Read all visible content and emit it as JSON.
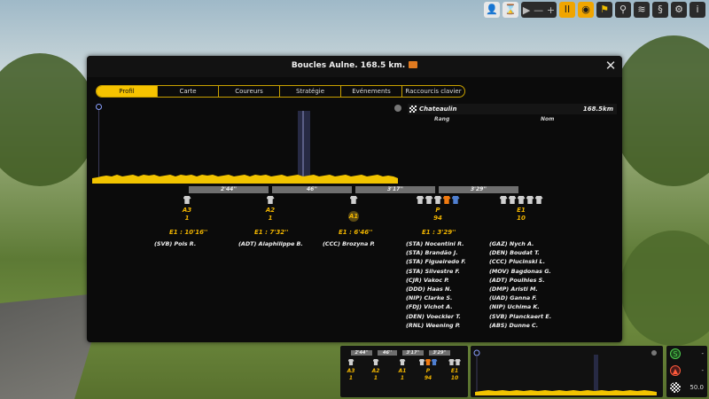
{
  "toolbar": {
    "items": [
      "user-icon",
      "hourglass-icon",
      "play-icon",
      "minus-icon",
      "plus-icon",
      "pause-icon",
      "eye-icon",
      "flag-icon",
      "bike-icon",
      "speed-icon",
      "s-icon",
      "settings-icon",
      "info-icon"
    ],
    "pause_symbol": "II",
    "minus_symbol": "—",
    "plus_symbol": "+",
    "info_symbol": "i"
  },
  "modal": {
    "title": "Boucles Aulne. 168.5 km.",
    "close_symbol": "✕",
    "tabs": [
      "Profil",
      "Carte",
      "Coureurs",
      "Stratégie",
      "Evénements",
      "Raccourcis clavier"
    ],
    "active_tab": "Profil"
  },
  "stage": {
    "place": "Chateaulin",
    "distance": "168.5km",
    "col_rank": "Rang",
    "col_name": "Nom",
    "gaps": [
      "2'44''",
      "46''",
      "3'17''",
      "3'29''"
    ]
  },
  "groups": [
    {
      "label": "A3",
      "count": "1",
      "gap": "E1 : 10'16''",
      "riders": [
        "(SVB) Pols R."
      ]
    },
    {
      "label": "A2",
      "count": "1",
      "gap": "E1 : 7'32''",
      "riders": [
        "(ADT) Alaphilippe B."
      ]
    },
    {
      "label": "A1",
      "count": "",
      "gap": "E1 : 6'46''",
      "riders": [
        "(CCC) Brozyna P."
      ]
    },
    {
      "label": "P",
      "count": "94",
      "gap": "E1 : 3'29''",
      "riders": [
        "(STA) Nocentini R.",
        "(STA) Brandão J.",
        "(STA) Figueiredo F.",
        "(STA) Silvestre F.",
        "(CJR) Vakoc P.",
        "(DDD) Haas N.",
        "(NIP) Clarke S.",
        "(FDJ) Vichot A.",
        "(DEN) Voeckler T.",
        "(RNL) Weening P."
      ]
    },
    {
      "label": "E1",
      "count": "10",
      "gap": "",
      "riders": [
        "(GAZ) Nych A.",
        "(DEN) Boudat T.",
        "(CCC) Plucinski L.",
        "(MOV) Bagdonas G.",
        "(ADT) Poulhies S.",
        "(DMP) Aristi M.",
        "(UAD) Ganna F.",
        "(NIP) Uchima K.",
        "(SVB) Planckaert E.",
        "(ABS) Dunne C."
      ]
    }
  ],
  "hud": {
    "gaps": [
      "2'44''",
      "46''",
      "3'17''",
      "3'29''"
    ],
    "groups": [
      {
        "label": "A3",
        "count": "1"
      },
      {
        "label": "A2",
        "count": "1"
      },
      {
        "label": "A1",
        "count": "1"
      },
      {
        "label": "P",
        "count": "94"
      },
      {
        "label": "E1",
        "count": "10"
      }
    ],
    "side": {
      "row1_value": "-",
      "row2_value": "-",
      "row3_value": "50.0",
      "row1_icon": "S",
      "row2_icon": "chart-icon",
      "row3_icon": "checkered-flag-icon"
    }
  },
  "colors": {
    "accent": "#f6c300",
    "gap_bar": "#6f6f6f",
    "profile_fill": "#f2c400",
    "leader_shirt": "#f07a10",
    "blue_shirt": "#4f7fd0"
  }
}
